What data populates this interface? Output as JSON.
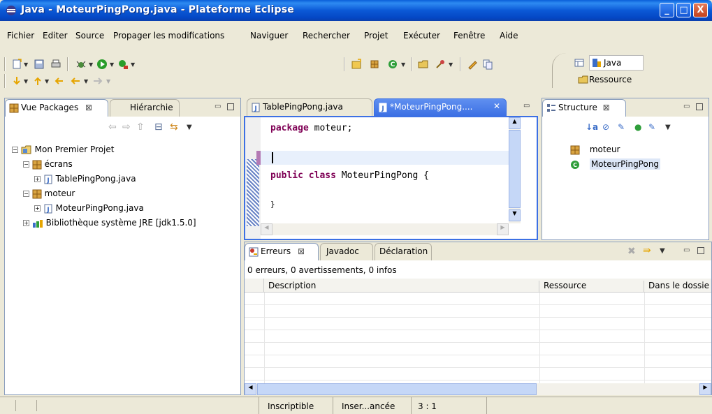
{
  "window": {
    "title": "Java - MoteurPingPong.java - Plateforme Eclipse",
    "controls": {
      "minimize": "_",
      "maximize": "□",
      "close": "X"
    }
  },
  "menubar": {
    "items": [
      "Fichier",
      "Editer",
      "Source",
      "Propager les modifications",
      "Naviguer",
      "Rechercher",
      "Projet",
      "Exécuter",
      "Fenêtre",
      "Aide"
    ]
  },
  "perspectives": {
    "java": "Java",
    "ressource": "Ressource"
  },
  "packages_view": {
    "tabs": [
      "Vue Packages",
      "Hiérarchie"
    ],
    "tree": [
      {
        "label": "Mon Premier Projet",
        "icon": "project-folder-icon"
      },
      {
        "label": "écrans",
        "icon": "package-icon"
      },
      {
        "label": "TablePingPong.java",
        "icon": "java-file-icon"
      },
      {
        "label": "moteur",
        "icon": "package-icon"
      },
      {
        "label": "MoteurPingPong.java",
        "icon": "java-file-icon"
      },
      {
        "label": "Bibliothèque système JRE [jdk1.5.0]",
        "icon": "library-icon"
      }
    ]
  },
  "editor": {
    "tabs": [
      "TablePingPong.java",
      "*MoteurPingPong...."
    ],
    "code": {
      "line1_kw": "package",
      "line1_rest": " moteur;",
      "line3_kw1": "public",
      "line3_kw2": "class",
      "line3_rest": " MoteurPingPong {",
      "line5": "}"
    }
  },
  "outline": {
    "tab": "Structure",
    "items": [
      "moteur",
      "MoteurPingPong"
    ]
  },
  "problems": {
    "tabs": [
      "Erreurs",
      "Javadoc",
      "Déclaration"
    ],
    "summary": "0 erreurs, 0 avertissements, 0 infos",
    "columns": [
      "Description",
      "Ressource",
      "Dans le dossie"
    ]
  },
  "status": {
    "mode": "Inscriptible",
    "insert": "Inser...ancée",
    "position": "3 : 1"
  },
  "colors": {
    "title_bar": "#0b59d6",
    "keyword": "#7f0055",
    "active_tab": "#3c70e4",
    "selection": "#c5d7f7"
  }
}
